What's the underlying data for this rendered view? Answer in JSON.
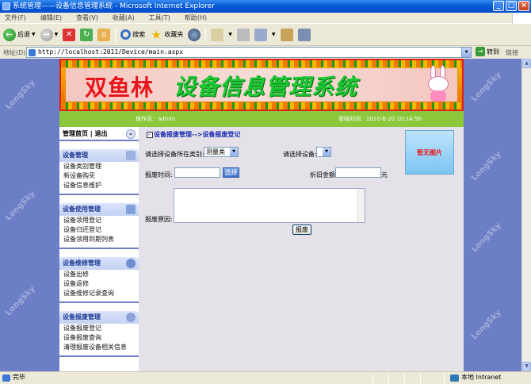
{
  "window": {
    "title": "系统管理——设备信息管理系统 - Microsoft Internet Explorer",
    "minimize": "_",
    "maximize": "□",
    "close": "×"
  },
  "menu": [
    "文件(F)",
    "编辑(E)",
    "查看(V)",
    "收藏(A)",
    "工具(T)",
    "帮助(H)"
  ],
  "toolbar": {
    "back_label": "后退",
    "search_label": "搜索",
    "favorites_label": "收藏夹"
  },
  "address": {
    "label": "地址(D)",
    "url": "http://localhost:2011/Device/main.aspx",
    "go_label": "转到",
    "links_label": "链接"
  },
  "banner": {
    "title_red": "双鱼林",
    "title_green": "设备信息管理系统"
  },
  "userbar": {
    "operator": "操作员：admin",
    "login_time": "登陆时间：2010-6-20 10:14:50"
  },
  "sidebar": {
    "top_links": "管理首页 | 退出",
    "collapse": "«",
    "groups": [
      {
        "title": "设备管理",
        "items": [
          "设备类别管理",
          "新设备购买",
          "设备信息维护"
        ]
      },
      {
        "title": "设备使用管理",
        "items": [
          "设备领用登记",
          "设备归还登记",
          "设备领用到期列表"
        ]
      },
      {
        "title": "设备维修管理",
        "items": [
          "设备出修",
          "设备返修",
          "设备维修记录查询"
        ]
      },
      {
        "title": "设备报废管理",
        "items": [
          "设备报废登记",
          "设备报废查询",
          "清理报废设备相关信息"
        ]
      }
    ]
  },
  "content": {
    "breadcrumb": "设备报废管理-->设备报废登记",
    "category_label": "请选择设备所在类别:",
    "category_value": "测量类",
    "device_label": "请选择设备:",
    "device_value": "",
    "scrap_time_label": "报废时间:",
    "pick_button": "选择",
    "depreciation_label": "折旧金额:",
    "currency_unit": "元",
    "reason_label": "报废原因:",
    "submit_button": "报废",
    "photo_placeholder": "暂无图片"
  },
  "status": {
    "left": "完毕",
    "zone": "本地 Intranet"
  },
  "watermark": "LongSky",
  "colors": {
    "page_bg": "#6C7FC6",
    "userbar": "#8CC83C",
    "title_red": "#E8141B",
    "title_green": "#19C832"
  }
}
